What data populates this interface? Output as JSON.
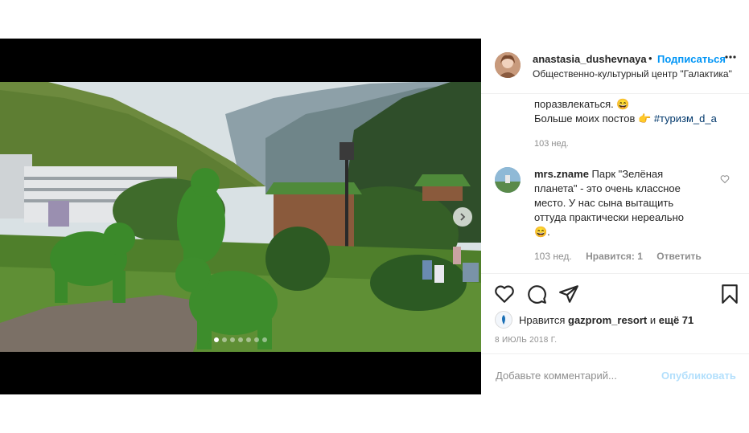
{
  "post": {
    "username": "anastasia_dushevnaya",
    "separator": "•",
    "follow_label": "Подписаться",
    "location": "Общественно-культурный центр \"Галактика\"",
    "more_icon": "ellipsis-icon",
    "carousel": {
      "total": 7,
      "current": 1
    }
  },
  "caption": {
    "line1": "поразвлекаться.",
    "emoji1": "😄",
    "line2": "Больше моих постов",
    "emoji2": "👉",
    "hashtag": "#туризм_d_a",
    "time": "103 нед."
  },
  "comment": {
    "username": "mrs.zname",
    "text": "Парк \"Зелёная планета\" - это очень классное место. У нас сына вытащить оттуда практически нереально",
    "emoji": "😄.",
    "time": "103 нед.",
    "likes": "Нравится: 1",
    "reply": "Ответить"
  },
  "likes": {
    "prefix": "Нравится",
    "user": "gazprom_resort",
    "conj": "и",
    "others": "ещё 71"
  },
  "date": "8 ИЮЛЬ 2018 Г.",
  "add_comment": {
    "placeholder": "Добавьте комментарий...",
    "publish_label": "Опубликовать"
  },
  "colors": {
    "accent": "#0095f6",
    "publish_disabled": "#b2dffc",
    "hashtag": "#00376b"
  }
}
